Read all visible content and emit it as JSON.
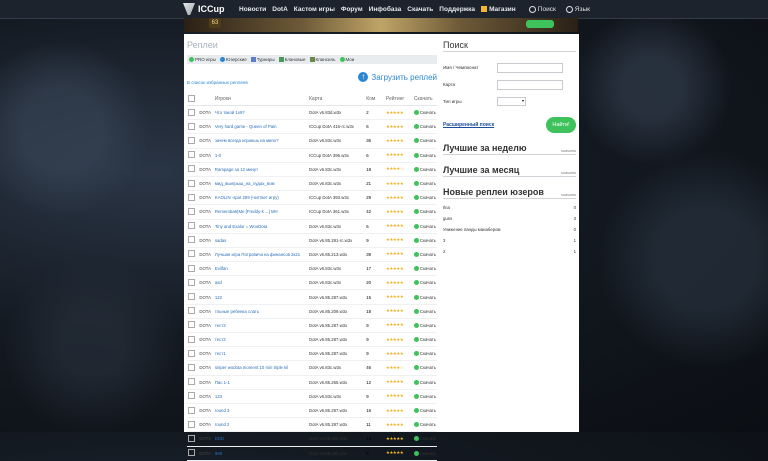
{
  "nav": {
    "logo": "ICCup",
    "items": [
      "Новости",
      "DotA",
      "Кастом игры",
      "Форум",
      "Инфобаза",
      "Скачать",
      "Поддержка",
      "Магазин"
    ],
    "search": "Поиск",
    "language": "Язык"
  },
  "banner": {
    "level": "63"
  },
  "replays": {
    "title": "Реплеи",
    "filters": [
      "PRO игры",
      "Юзерские",
      "Турниры",
      "Клановые",
      "Клансиль",
      "Мои"
    ],
    "upload": "Загрузить реплей",
    "favorites": "В список избранных реплеев",
    "columns": [
      "Игроки",
      "Карта",
      "Ком",
      "Рейтинг",
      "Скачать"
    ],
    "download_label": "Скачать",
    "rows": [
      {
        "game": "DOTA",
        "title": "Что такой 1х9?",
        "map": "DotA v6.83d.w3x",
        "com": "2",
        "stars": "★★★★★"
      },
      {
        "game": "DOTA",
        "title": "Very hard game - Queen of Pain",
        "map": "ICCup DotA 415-rc.w3x",
        "com": "6",
        "stars": "★★★★★"
      },
      {
        "game": "DOTA",
        "title": "зачем всегда играешь на мипо?",
        "map": "DotA v6.83c.w3x",
        "com": "36",
        "stars": "★★★★★"
      },
      {
        "game": "DOTA",
        "title": "1-0",
        "map": "ICCup DotA 396.w3x",
        "com": "6",
        "stars": "★★★★★"
      },
      {
        "game": "DOTA",
        "title": "Rampage за 12 минут",
        "map": "DotA v6.83c.w3x",
        "com": "18",
        "stars": "★★★★☆"
      },
      {
        "game": "DOTA",
        "title": "мид_выигрыш_на_лудах_вом",
        "map": "DotA v6.83c.w3x",
        "com": "21",
        "stars": "★★★★★"
      },
      {
        "game": "DOTA",
        "title": "KAOLIN -spot 299 (чептвет игру)",
        "map": "ICCup DotA 393.w3x",
        "com": "29",
        "stars": "★★★★★"
      },
      {
        "game": "DOTA",
        "title": "Rememba6(Me [Freddy-k ...] MH",
        "map": "ICCup DotA 361.w3x",
        "com": "42",
        "stars": "★★★★★"
      },
      {
        "game": "DOTA",
        "title": "Tiny and Exalor = WooDota",
        "map": "DotA v6.83c.w3x",
        "com": "6",
        "stars": "★★★★★"
      },
      {
        "game": "DOTA",
        "title": "sadas",
        "map": "DotA v6.85.291-rc.w3x",
        "com": "9",
        "stars": "★★★★★"
      },
      {
        "game": "DOTA",
        "title": "Лучшая игра Потровича на финансов 2к21",
        "map": "DotA v6.85.213.w3x",
        "com": "39",
        "stars": "★★★★★"
      },
      {
        "game": "DOTA",
        "title": "Evilfan",
        "map": "DotA v6.83c.w3x",
        "com": "17",
        "stars": "★★★★★"
      },
      {
        "game": "DOTA",
        "title": "asd",
        "map": "DotA v6.83c.w3x",
        "com": "20",
        "stars": "★★★★★"
      },
      {
        "game": "DOTA",
        "title": "122",
        "map": "DotA v6.85.287.w3x",
        "com": "15",
        "stars": "★★★★★"
      },
      {
        "game": "DOTA",
        "title": "тльные ребенка слать",
        "map": "DotA v6.85.209.w3x",
        "com": "18",
        "stars": "★★★★★"
      },
      {
        "game": "DOTA",
        "title": "тест3",
        "map": "DotA v6.85.287.w3x",
        "com": "9",
        "stars": "★★★★★"
      },
      {
        "game": "DOTA",
        "title": "тест2",
        "map": "DotA v6.85.287.w3x",
        "com": "9",
        "stars": "★★★★★"
      },
      {
        "game": "DOTA",
        "title": "тест1",
        "map": "DotA v6.85.287.w3x",
        "com": "9",
        "stars": "★★★★★"
      },
      {
        "game": "DOTA",
        "title": "sniper wodota moment 10 min triple kil",
        "map": "DotA v6.83c.w3x",
        "com": "46",
        "stars": "★★★★☆"
      },
      {
        "game": "DOTA",
        "title": "Пас 1-1",
        "map": "DotA v6.85.265.w3x",
        "com": "12",
        "stars": "★★★★★"
      },
      {
        "game": "DOTA",
        "title": "123",
        "map": "DotA v6.83c.w3x",
        "com": "9",
        "stars": "★★★★★"
      },
      {
        "game": "DOTA",
        "title": "round 3",
        "map": "DotA v6.85.297.w3x",
        "com": "16",
        "stars": "★★★★★"
      },
      {
        "game": "DOTA",
        "title": "round 2",
        "map": "DotA v6.85.297.w3x",
        "com": "11",
        "stars": "★★★★★"
      },
      {
        "game": "DOTA",
        "title": "DDD",
        "map": "DotA v6.85.280.w3x",
        "com": "13",
        "stars": "★★★★★"
      },
      {
        "game": "DOTA",
        "title": "999",
        "map": "DotA v6.85.280.w3x",
        "com": "8",
        "stars": "★★★★★"
      }
    ]
  },
  "search": {
    "title": "Поиск",
    "name_label": "Имя / Чемпионат",
    "map_label": "Карта",
    "game_type_label": "Тип игры",
    "advanced": "Расширенный поиск",
    "find": "Найти!"
  },
  "sections": {
    "best_week": "Лучшие за неделю",
    "best_month": "Лучшие за месяц",
    "new_user": "Новые реплеи юзеров",
    "more": "скачано"
  },
  "user_replays": [
    {
      "name": "Ilna",
      "count": "0"
    },
    {
      "name": "guns",
      "count": "3"
    },
    {
      "name": "Унижение панды манабером",
      "count": "0"
    },
    {
      "name": "3",
      "count": "1"
    },
    {
      "name": "2",
      "count": "1"
    }
  ],
  "colors": {
    "accent": "#2a86d3",
    "green": "#3ec35c",
    "star": "#f0b429"
  }
}
